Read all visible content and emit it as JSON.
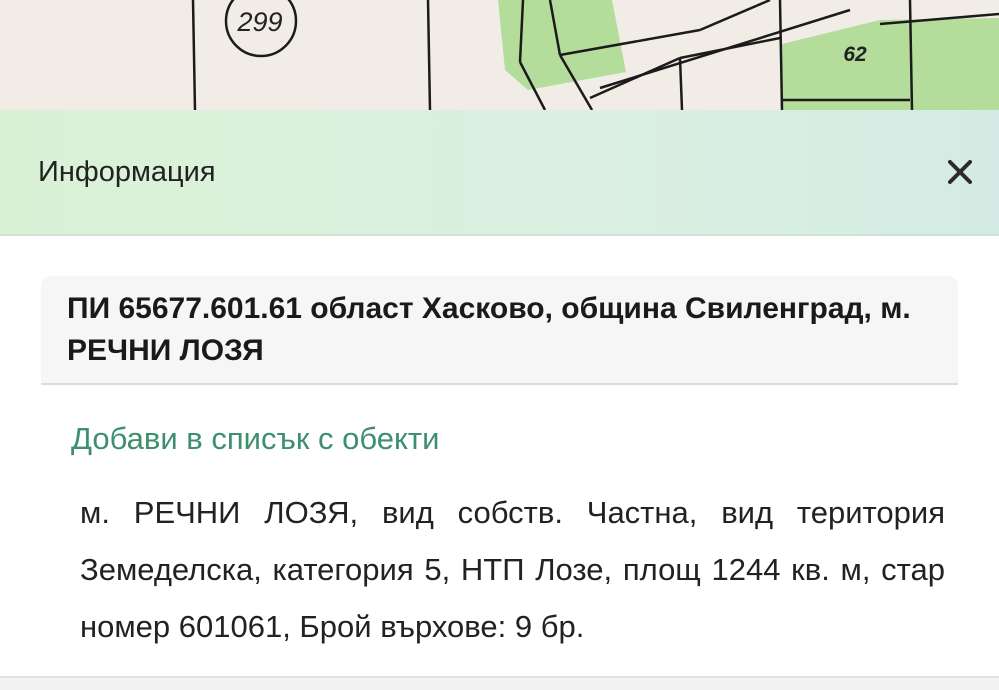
{
  "map": {
    "parcel_labels": [
      "299",
      "62"
    ],
    "colors": {
      "background": "#f1ece6",
      "vineyard_green": "#a9db8e"
    }
  },
  "panel": {
    "title": "Информация",
    "close_icon": "close-icon"
  },
  "property": {
    "title": "ПИ 65677.601.61 област Хасково, община Свиленград, м. РЕЧНИ ЛОЗЯ",
    "add_link": "Добави в списък с обекти",
    "description": "м. РЕЧНИ ЛОЗЯ, вид собств. Частна, вид територия Земеделска, категория 5, НТП Лозе, площ 1244 кв. м, стар номер 601061, Брой върхове: 9 бр."
  },
  "colors": {
    "accent": "#3d8f6f",
    "header_green": "#d9f2d6"
  }
}
